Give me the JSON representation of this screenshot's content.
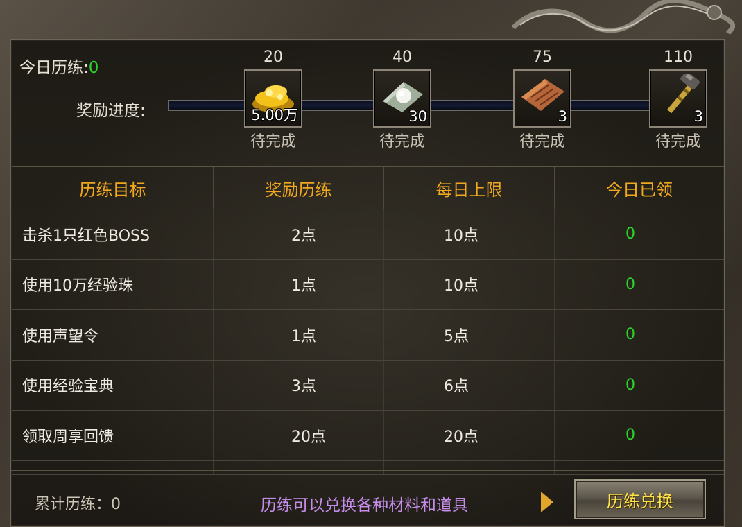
{
  "header": {
    "today_label": "今日历练:",
    "today_value": "0",
    "progress_label": "奖励进度:"
  },
  "milestones": [
    {
      "need": "20",
      "item_icon": "gold-coins-icon",
      "qty": "5.00万",
      "status": "待完成"
    },
    {
      "need": "40",
      "item_icon": "pearl-scroll-icon",
      "qty": "30",
      "status": "待完成"
    },
    {
      "need": "75",
      "item_icon": "rune-scroll-icon",
      "qty": "3",
      "status": "待完成"
    },
    {
      "need": "110",
      "item_icon": "hammer-icon",
      "qty": "3",
      "status": "待完成"
    }
  ],
  "table": {
    "headers": [
      "历练目标",
      "奖励历练",
      "每日上限",
      "今日已领"
    ],
    "rows": [
      {
        "goal": "击杀1只红色BOSS",
        "reward": "2点",
        "limit": "10点",
        "claimed": "0"
      },
      {
        "goal": "使用10万经验珠",
        "reward": "1点",
        "limit": "10点",
        "claimed": "0"
      },
      {
        "goal": "使用声望令",
        "reward": "1点",
        "limit": "5点",
        "claimed": "0"
      },
      {
        "goal": "使用经验宝典",
        "reward": "3点",
        "limit": "6点",
        "claimed": "0"
      },
      {
        "goal": "领取周享回馈",
        "reward": "20点",
        "limit": "20点",
        "claimed": "0"
      }
    ]
  },
  "footer": {
    "total_label": "累计历练：0",
    "tip": "历练可以兑换各种材料和道具",
    "exchange_button": "历练兑换"
  },
  "colors": {
    "accent_gold": "#f0a81e",
    "value_green": "#2ad32a",
    "tip_purple": "#c58ce8",
    "button_text": "#ffe24a"
  }
}
